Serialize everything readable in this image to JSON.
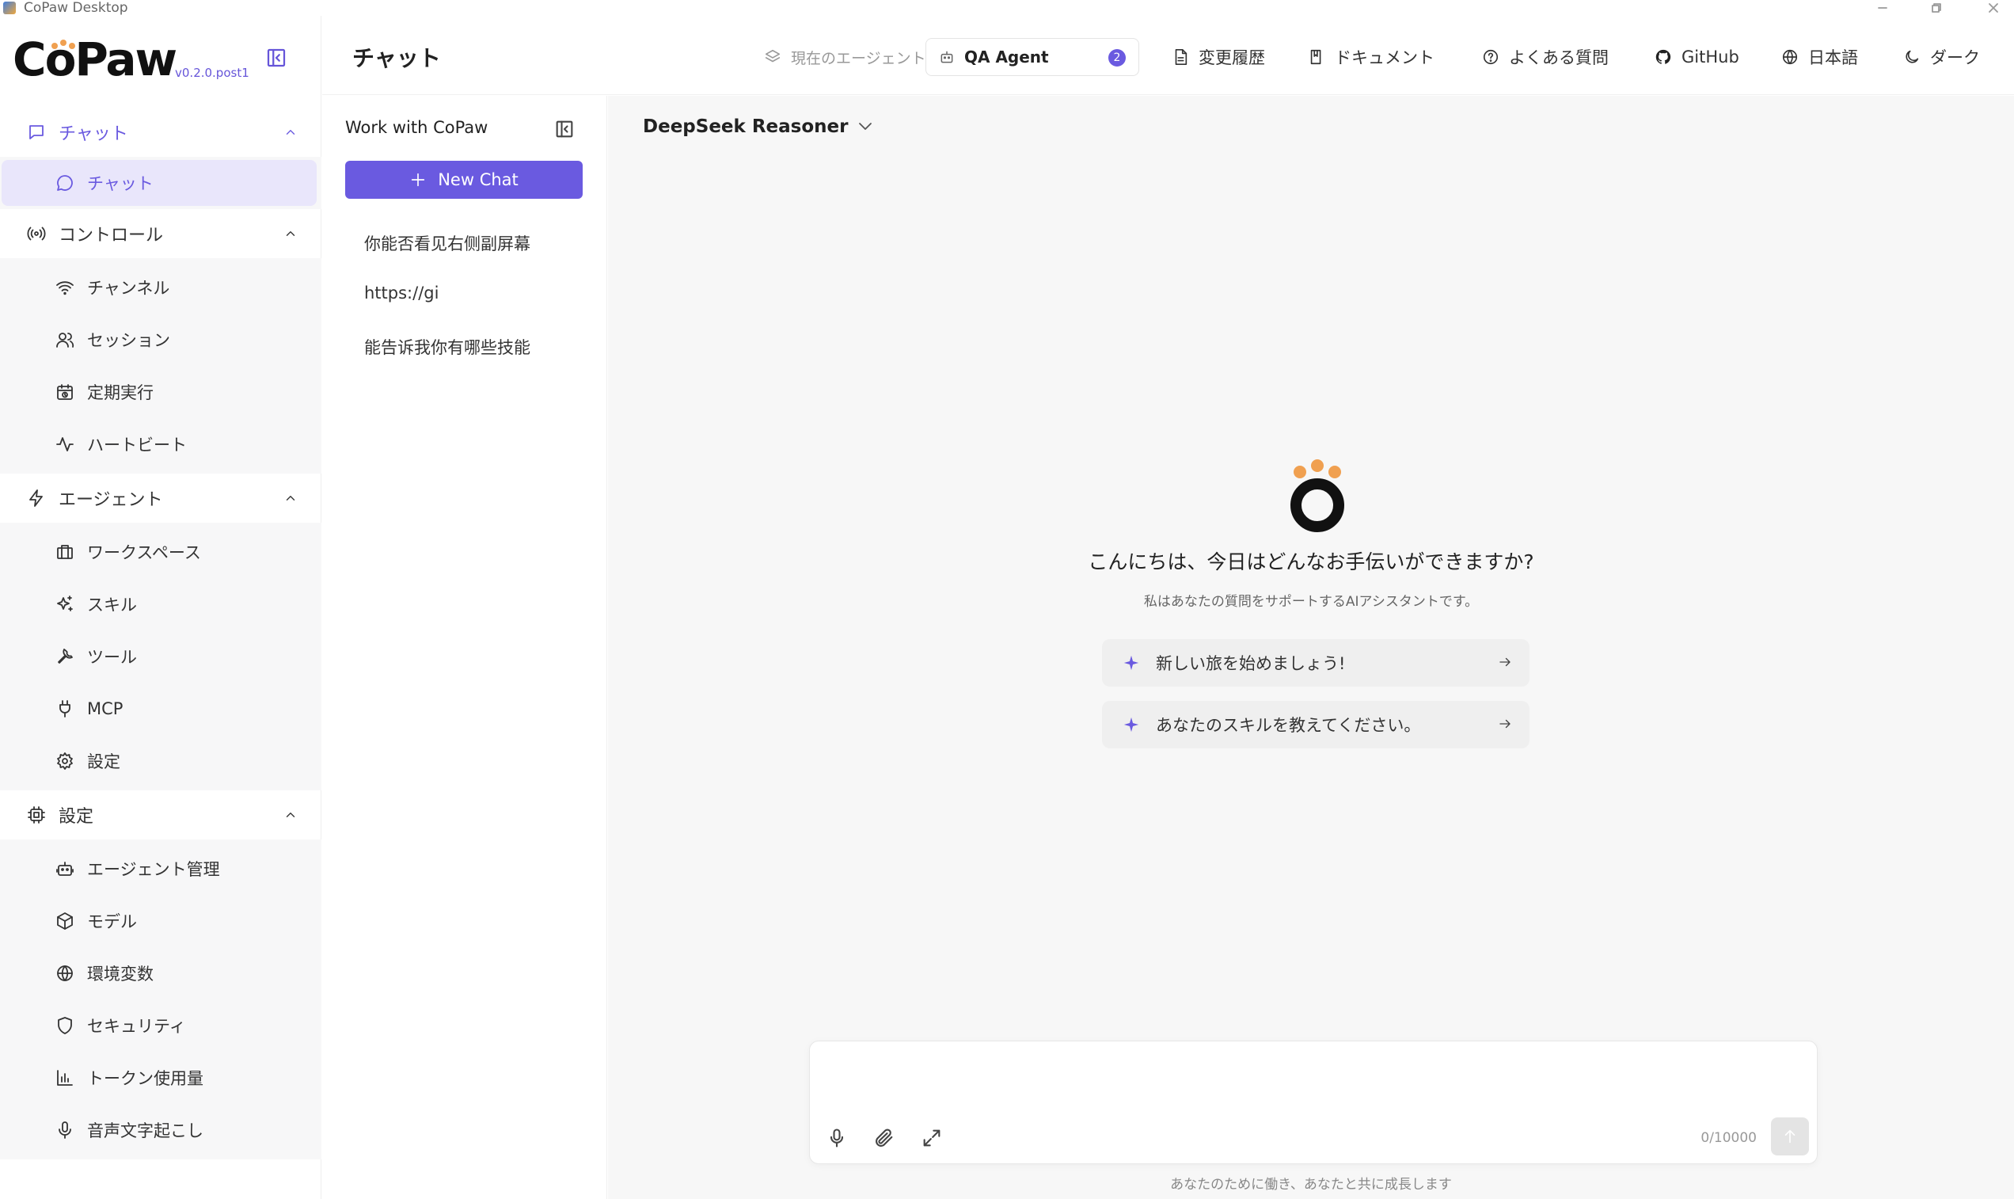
{
  "window": {
    "title": "CoPaw Desktop"
  },
  "brand": {
    "logo_text": "CoPaw",
    "version": "v0.2.0.post1"
  },
  "colors": {
    "accent": "#6a5ae0",
    "logo_dots": "#f0a050"
  },
  "sidebar": {
    "groups": [
      {
        "label": "チャット",
        "icon": "chat-bubble-icon",
        "items": [
          {
            "label": "チャット",
            "icon": "chat-bubble-icon",
            "selected": true
          }
        ]
      },
      {
        "label": "コントロール",
        "icon": "broadcast-icon",
        "items": [
          {
            "label": "チャンネル",
            "icon": "wifi-icon"
          },
          {
            "label": "セッション",
            "icon": "users-icon"
          },
          {
            "label": "定期実行",
            "icon": "calendar-clock-icon"
          },
          {
            "label": "ハートビート",
            "icon": "pulse-icon"
          }
        ]
      },
      {
        "label": "エージェント",
        "icon": "bolt-icon",
        "items": [
          {
            "label": "ワークスペース",
            "icon": "briefcase-icon"
          },
          {
            "label": "スキル",
            "icon": "sparkles-icon"
          },
          {
            "label": "ツール",
            "icon": "wrench-icon"
          },
          {
            "label": "MCP",
            "icon": "plug-icon"
          },
          {
            "label": "設定",
            "icon": "gear-icon"
          }
        ]
      },
      {
        "label": "設定",
        "icon": "cpu-icon",
        "items": [
          {
            "label": "エージェント管理",
            "icon": "robot-icon"
          },
          {
            "label": "モデル",
            "icon": "cube-icon"
          },
          {
            "label": "環境変数",
            "icon": "globe-icon"
          },
          {
            "label": "セキュリティ",
            "icon": "shield-icon"
          },
          {
            "label": "トークン使用量",
            "icon": "bar-chart-icon"
          },
          {
            "label": "音声文字起こし",
            "icon": "microphone-icon"
          }
        ]
      }
    ]
  },
  "header": {
    "page_title": "チャット",
    "current_agent_label": "現在のエージェント",
    "agent_name": "QA Agent",
    "agent_count": "2",
    "changelog": "変更履歴",
    "docs": "ドキュメント",
    "faq": "よくある質問",
    "github": "GitHub",
    "language": "日本語",
    "theme": "ダーク"
  },
  "chat_panel": {
    "title": "Work with CoPaw",
    "new_chat": "New Chat",
    "history": [
      "你能否看见右侧副屏幕",
      "https://gi",
      "能告诉我你有哪些技能"
    ]
  },
  "main": {
    "model": "DeepSeek Reasoner",
    "welcome_title": "こんにちは、今日はどんなお手伝いができますか?",
    "welcome_subtitle": "私はあなたの質問をサポートするAIアシスタントです。",
    "suggestions": [
      "新しい旅を始めましょう!",
      "あなたのスキルを教えてください。"
    ],
    "input_placeholder": "",
    "char_counter": "0/10000",
    "footer_note": "あなたのために働き、あなたと共に成長します"
  }
}
